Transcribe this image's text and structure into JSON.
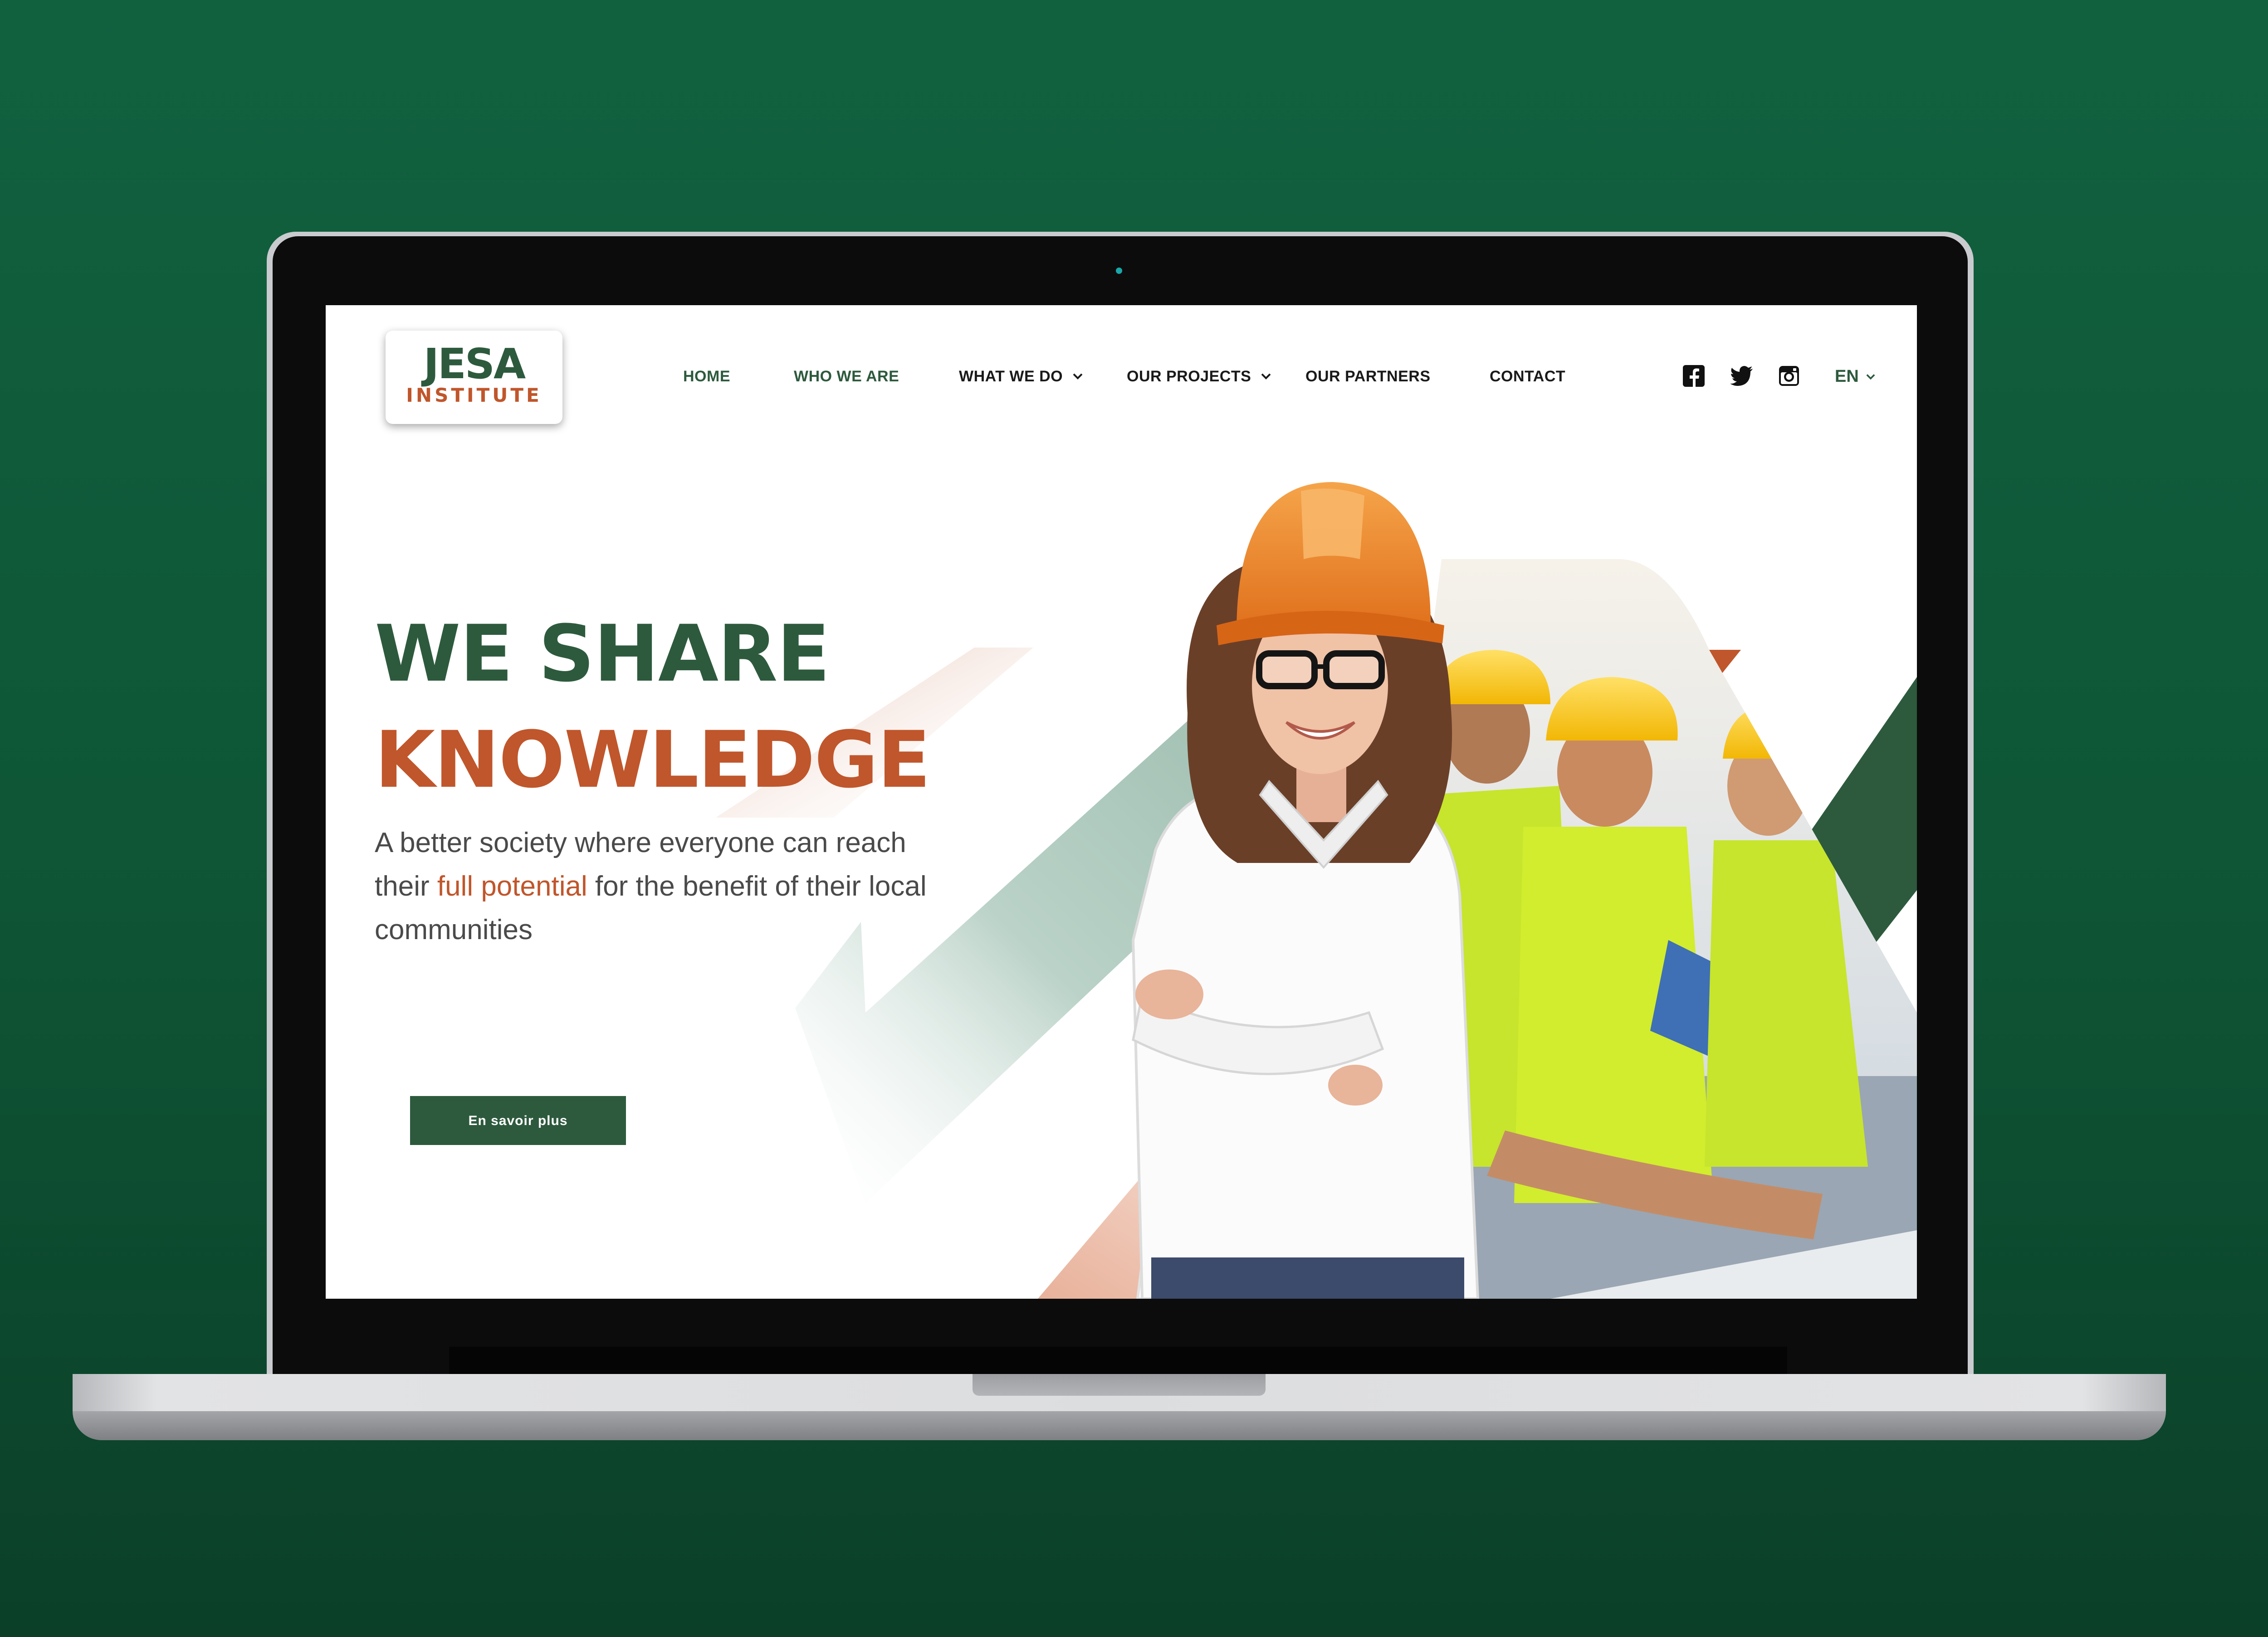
{
  "logo": {
    "line1": "JESA",
    "line2": "INSTITUTE"
  },
  "nav": {
    "items": [
      {
        "label": "HOME"
      },
      {
        "label": "WHO WE ARE"
      },
      {
        "label": "WHAT WE DO"
      },
      {
        "label": "OUR PROJECTS"
      },
      {
        "label": "OUR PARTNERS"
      },
      {
        "label": "CONTACT"
      }
    ],
    "language": "EN"
  },
  "social_icons": [
    "facebook-icon",
    "twitter-icon",
    "instagram-icon"
  ],
  "hero": {
    "title_line1": "WE SHARE",
    "title_line2": "KNOWLEDGE",
    "subtitle_part1": "A better society where everyone can reach their ",
    "subtitle_highlight": "full potential",
    "subtitle_part2": " for the benefit of their local communities",
    "cta_label": "En savoir plus"
  },
  "colors": {
    "brand_green": "#2d5a3d",
    "brand_orange": "#c0562b",
    "page_background": "#0f5a3a"
  }
}
